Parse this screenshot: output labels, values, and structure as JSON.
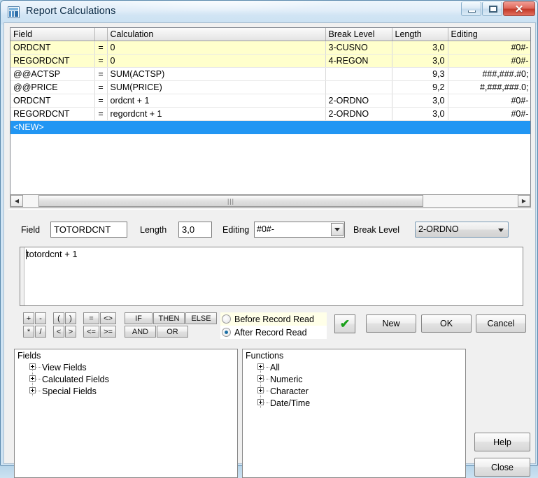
{
  "window": {
    "title": "Report Calculations",
    "icon": "calculator-icon",
    "buttons": {
      "minimize": "–",
      "maximize": "□",
      "close": "✕"
    }
  },
  "grid": {
    "columns": [
      "Field",
      "",
      "Calculation",
      "Break Level",
      "Length",
      "Editing"
    ],
    "rows": [
      {
        "field": "ORDCNT",
        "eq": "=",
        "calculation": "0",
        "break_level": "3-CUSNO",
        "length": "3,0",
        "editing": "#0#-",
        "style": "yellow"
      },
      {
        "field": "REGORDCNT",
        "eq": "=",
        "calculation": "0",
        "break_level": "4-REGON",
        "length": "3,0",
        "editing": "#0#-",
        "style": "yellow"
      },
      {
        "field": "@@ACTSP",
        "eq": "=",
        "calculation": "SUM(ACTSP)",
        "break_level": "",
        "length": "9,3",
        "editing": "###,###.#0;",
        "style": "plain"
      },
      {
        "field": "@@PRICE",
        "eq": "=",
        "calculation": "SUM(PRICE)",
        "break_level": "",
        "length": "9,2",
        "editing": "#,###,###.0;",
        "style": "plain"
      },
      {
        "field": "ORDCNT",
        "eq": "=",
        "calculation": "ordcnt + 1",
        "break_level": "2-ORDNO",
        "length": "3,0",
        "editing": "#0#-",
        "style": "plain"
      },
      {
        "field": "REGORDCNT",
        "eq": "=",
        "calculation": "regordcnt + 1",
        "break_level": "2-ORDNO",
        "length": "3,0",
        "editing": "#0#-",
        "style": "plain"
      },
      {
        "field": "<NEW>",
        "eq": "",
        "calculation": "",
        "break_level": "",
        "length": "",
        "editing": "",
        "style": "sel"
      }
    ],
    "scrollbar": {
      "left_arrow": "◀",
      "right_arrow": "▶",
      "thumb_grip": "|||"
    }
  },
  "form": {
    "field_label": "Field",
    "field_value": "TOTORDCNT",
    "length_label": "Length",
    "length_value": "3,0",
    "editing_label": "Editing",
    "editing_value": "#0#-",
    "break_level_label": "Break Level",
    "break_level_value": "2-ORDNO",
    "expression": "totordcnt + 1"
  },
  "operators": {
    "row1": [
      "+",
      "-",
      "(",
      ")",
      "=",
      "<>",
      "IF",
      "THEN",
      "ELSE"
    ],
    "row2": [
      "*",
      "/",
      "<",
      ">",
      "<=",
      ">=",
      "AND",
      "OR"
    ]
  },
  "timing": {
    "before_label": "Before Record Read",
    "after_label": "After Record Read",
    "selected": "After Record Read"
  },
  "actions": {
    "validate": "✔",
    "new": "New",
    "ok": "OK",
    "cancel": "Cancel",
    "help": "Help",
    "close": "Close"
  },
  "fields_tree": {
    "title": "Fields",
    "nodes": [
      "View Fields",
      "Calculated Fields",
      "Special Fields"
    ]
  },
  "functions_tree": {
    "title": "Functions",
    "nodes": [
      "All",
      "Numeric",
      "Character",
      "Date/Time"
    ]
  },
  "colors": {
    "accent_selection": "#2196f3",
    "highlight_row": "#ffffcc",
    "title_text": "#0b2b45",
    "close_button": "#c33a29",
    "tick_green": "#1aa01a",
    "panel_bg": "#f0f0f0"
  }
}
